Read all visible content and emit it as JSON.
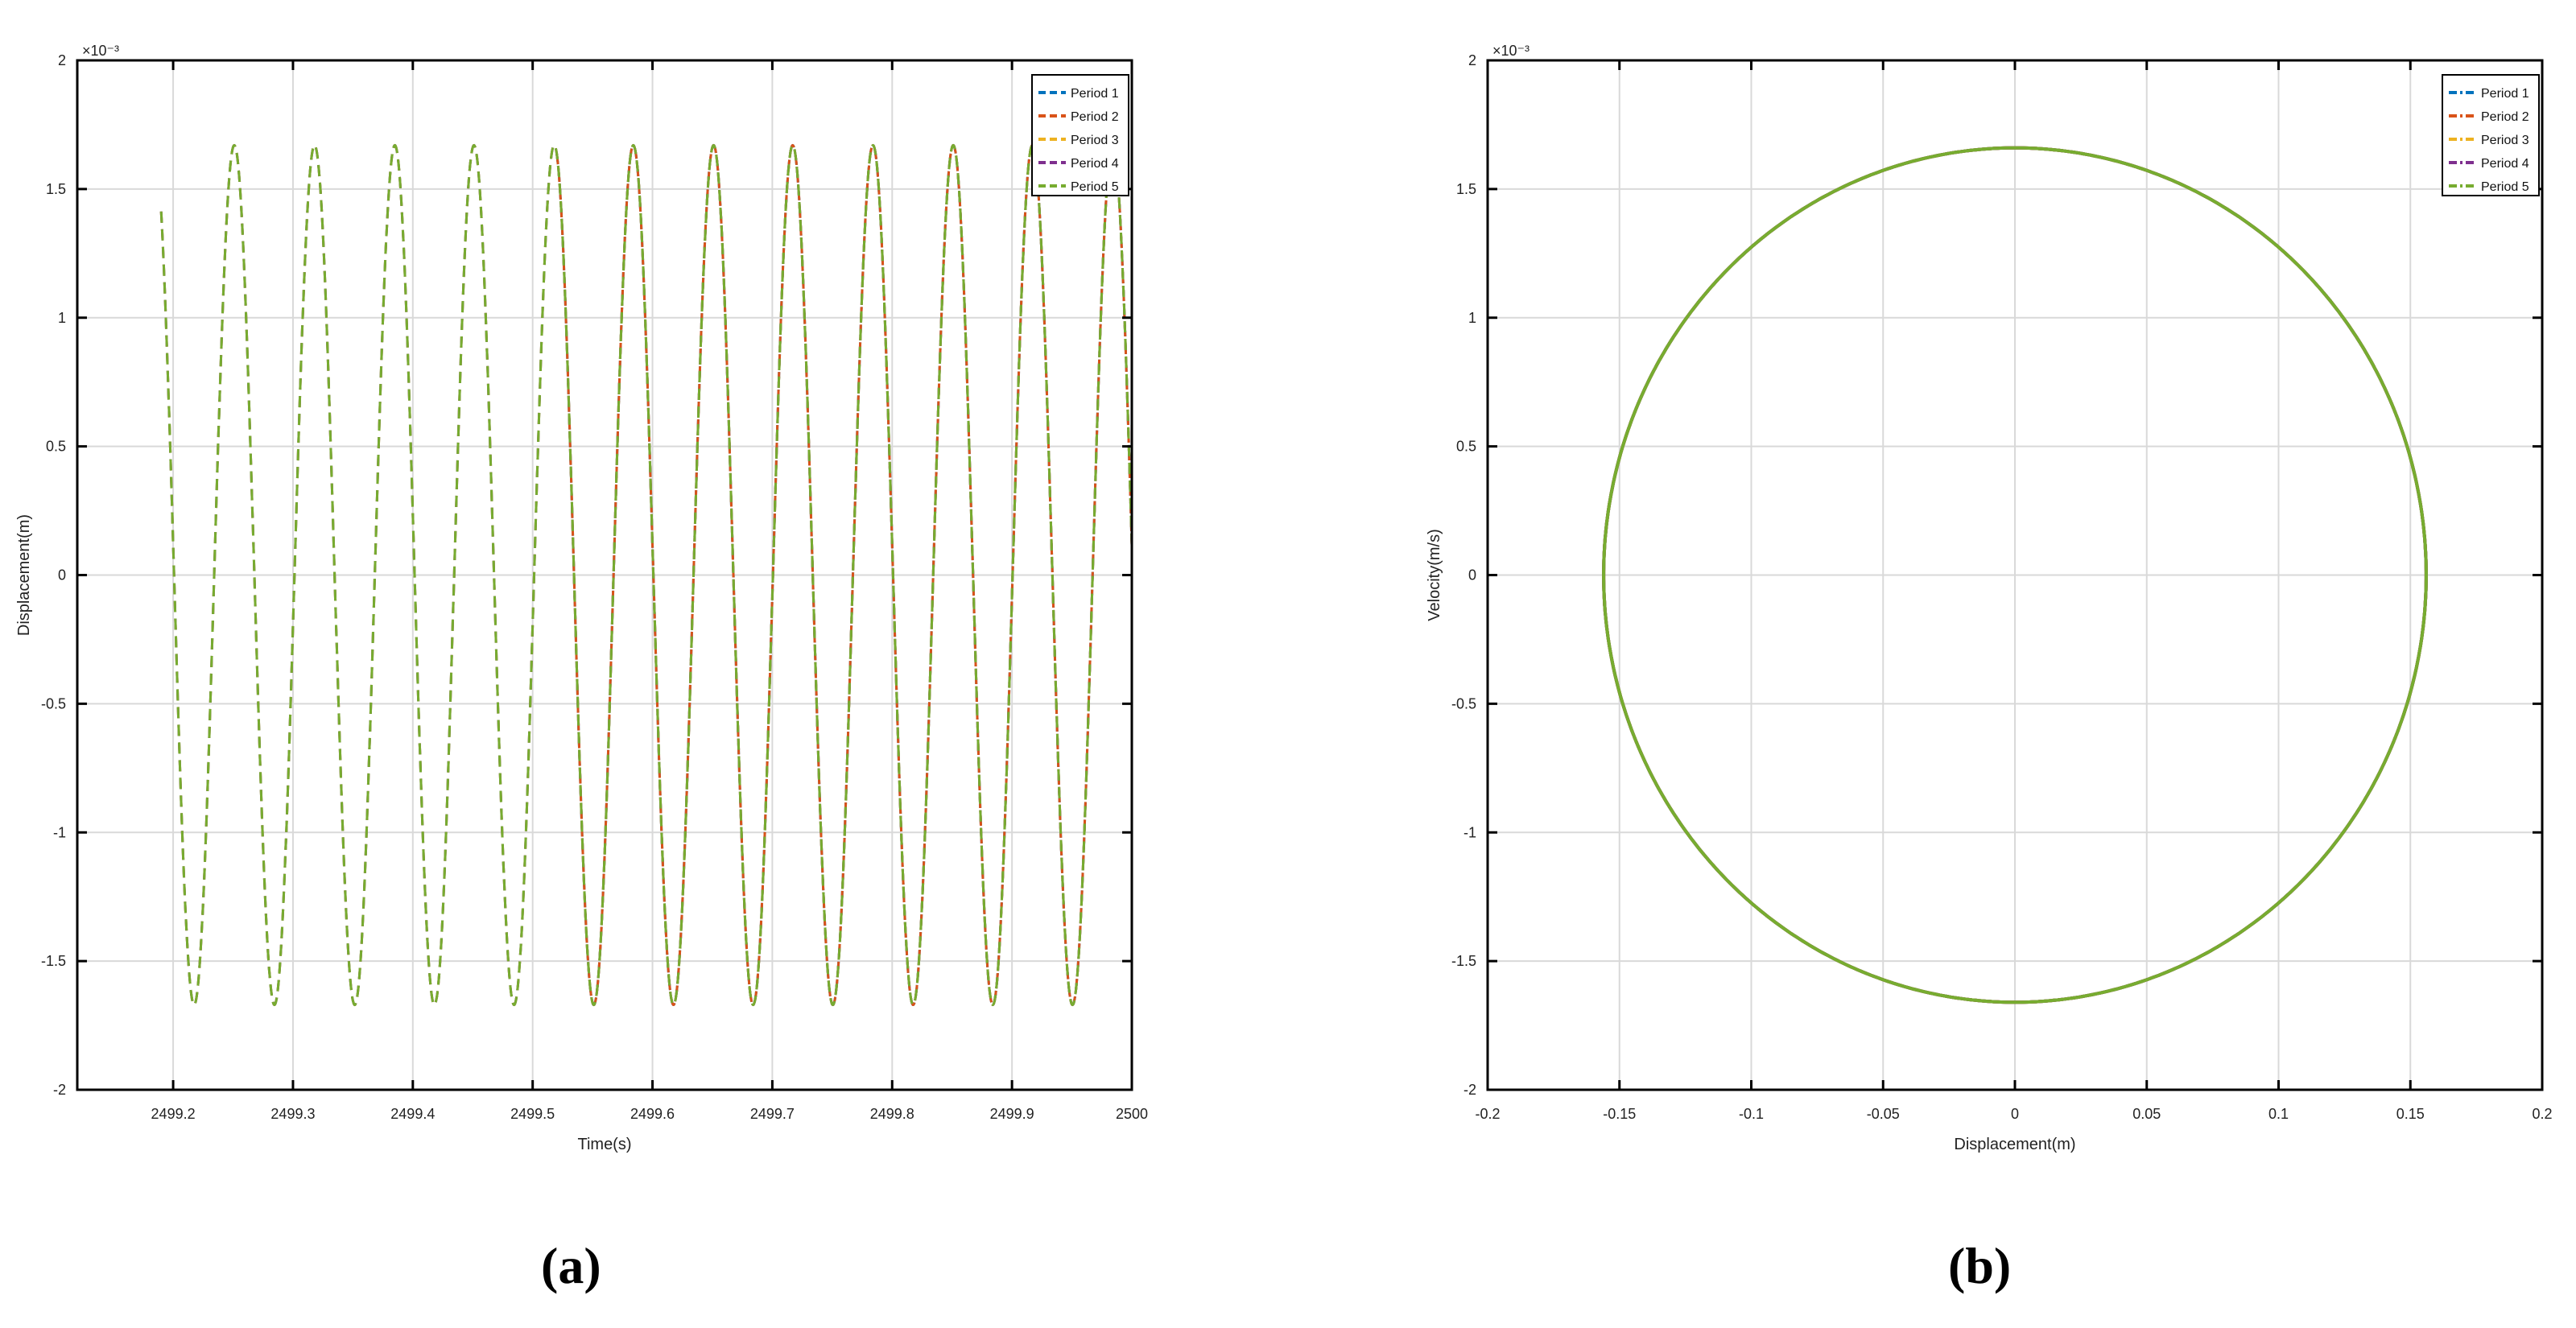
{
  "chart_data": [
    {
      "id": "a",
      "type": "line",
      "panel_label": "(a)",
      "xlabel": "Time(s)",
      "ylabel": "Displacement(m)",
      "exponent_label": "×10⁻³",
      "xlim": [
        2499.12,
        2500.0
      ],
      "ylim": [
        -2,
        2
      ],
      "y_scale_factor": 0.001,
      "xticks": [
        2499.2,
        2499.3,
        2499.4,
        2499.5,
        2499.6,
        2499.7,
        2499.8,
        2499.9,
        2500
      ],
      "xtick_labels": [
        "2499.2",
        "2499.3",
        "2499.4",
        "2499.5",
        "2499.6",
        "2499.7",
        "2499.8",
        "2499.9",
        "2500"
      ],
      "yticks": [
        -2,
        -1.5,
        -1,
        -0.5,
        0,
        0.5,
        1,
        1.5,
        2
      ],
      "ytick_labels": [
        "-2",
        "-1.5",
        "-1",
        "-0.5",
        "0",
        "0.5",
        "1",
        "1.5",
        "2"
      ],
      "grid": true,
      "legend_position": "top-right",
      "signal": {
        "amplitude": 1.67,
        "peak_times": [
          2499.251,
          2499.318,
          2499.385,
          2499.451,
          2499.518,
          2499.584,
          2499.651,
          2499.717,
          2499.784,
          2499.851,
          2499.917,
          2499.984
        ],
        "series_x_start": [
          2499.52,
          2499.52,
          2499.19,
          2499.19,
          2499.19
        ],
        "x_end": 2500.0
      },
      "series": [
        {
          "name": "Period 1",
          "color": "#0072BD",
          "dash": "dash"
        },
        {
          "name": "Period 2",
          "color": "#D95319",
          "dash": "dash"
        },
        {
          "name": "Period 3",
          "color": "#EDB120",
          "dash": "dash"
        },
        {
          "name": "Period 4",
          "color": "#7E2F8E",
          "dash": "dash"
        },
        {
          "name": "Period 5",
          "color": "#77AC30",
          "dash": "dash"
        }
      ]
    },
    {
      "id": "b",
      "type": "line",
      "panel_label": "(b)",
      "xlabel": "Displacement(m)",
      "ylabel": "Velocity(m/s)",
      "exponent_label": "×10⁻³",
      "xlim": [
        -0.2,
        0.2
      ],
      "ylim": [
        -2,
        2
      ],
      "y_scale_factor": 0.001,
      "xticks": [
        -0.2,
        -0.15,
        -0.1,
        -0.05,
        0,
        0.05,
        0.1,
        0.15,
        0.2
      ],
      "xtick_labels": [
        "-0.2",
        "-0.15",
        "-0.1",
        "-0.05",
        "0",
        "0.05",
        "0.1",
        "0.15",
        "0.2"
      ],
      "yticks": [
        -2,
        -1.5,
        -1,
        -0.5,
        0,
        0.5,
        1,
        1.5,
        2
      ],
      "ytick_labels": [
        "-2",
        "-1.5",
        "-1",
        "-0.5",
        "0",
        "0.5",
        "1",
        "1.5",
        "2"
      ],
      "grid": true,
      "legend_position": "top-right",
      "orbit": {
        "x_amplitude": 0.156,
        "y_amplitude": 1.66
      },
      "series": [
        {
          "name": "Period 1",
          "color": "#0072BD",
          "dash": "dashdot"
        },
        {
          "name": "Period 2",
          "color": "#D95319",
          "dash": "dashdot"
        },
        {
          "name": "Period 3",
          "color": "#EDB120",
          "dash": "dashdot"
        },
        {
          "name": "Period 4",
          "color": "#7E2F8E",
          "dash": "dashdot"
        },
        {
          "name": "Period 5",
          "color": "#77AC30",
          "dash": "dashdot"
        }
      ]
    }
  ]
}
